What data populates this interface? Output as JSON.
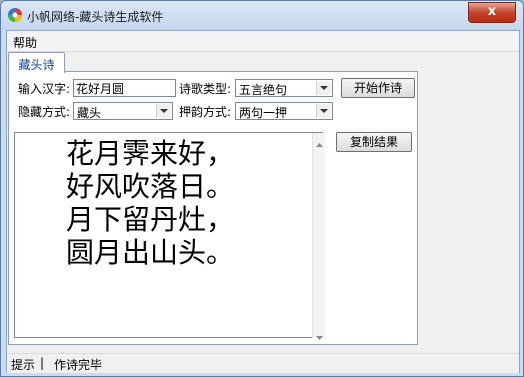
{
  "window": {
    "title": "小帆网络-藏头诗生成软件",
    "close_glyph": "x"
  },
  "menu": {
    "items": [
      "帮助"
    ]
  },
  "tabs": [
    {
      "label": "藏头诗"
    }
  ],
  "form": {
    "input_label": "输入汉字:",
    "input_value": "花好月圆",
    "poem_type_label": "诗歌类型:",
    "poem_type_value": "五言绝句",
    "start_button": "开始作诗",
    "hide_mode_label": "隐藏方式:",
    "hide_mode_value": "藏头",
    "rhyme_label": "押韵方式:",
    "rhyme_value": "两句一押",
    "copy_button": "复制结果"
  },
  "poem": {
    "lines": [
      "花月霁来好，",
      "好风吹落日。",
      "月下留丹灶，",
      "圆月出山头。"
    ]
  },
  "status": {
    "label": "提示",
    "separator": "|",
    "message": "作诗完毕"
  }
}
